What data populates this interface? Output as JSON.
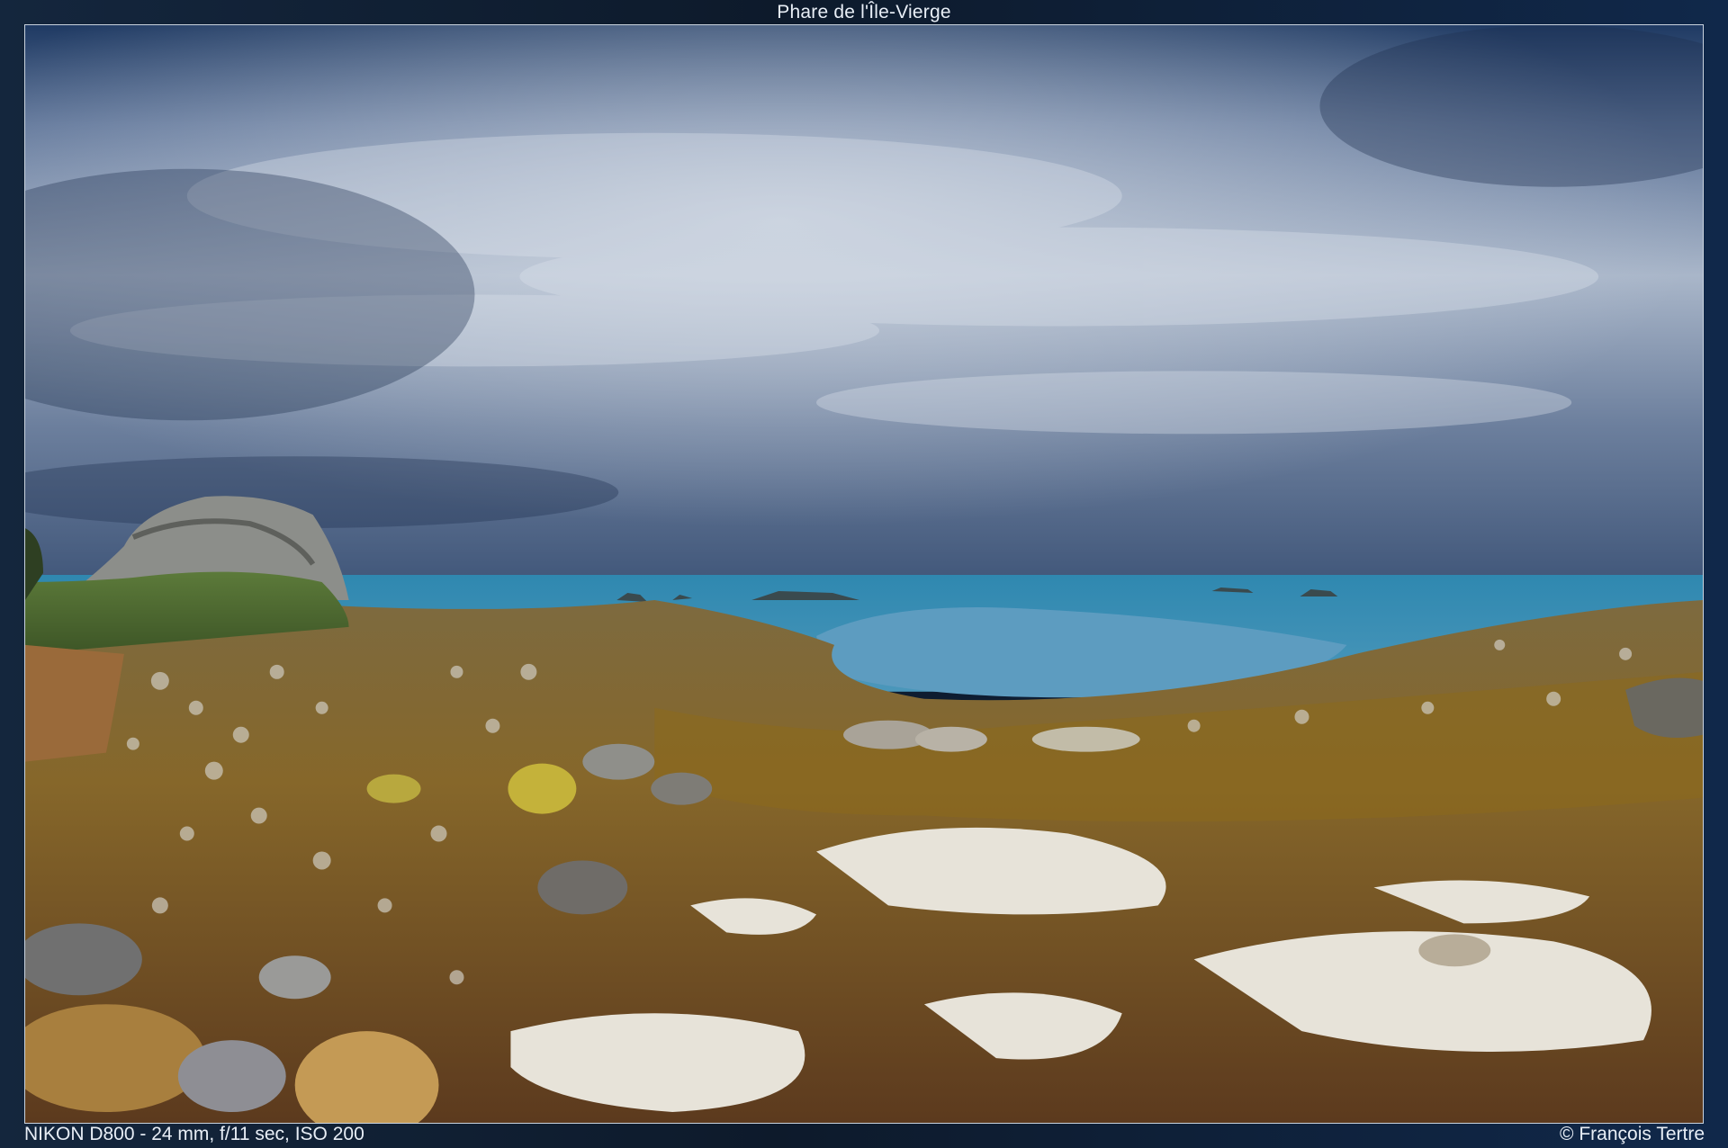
{
  "title": "Phare de l'Île-Vierge",
  "exif": "NIKON D800 - 24 mm, f/11 sec, ISO 200",
  "credit": "© François Tertre",
  "colors": {
    "sky_top": "#2a4a7a",
    "sky_mid": "#8a9cb8",
    "sea": "#3f8fb4",
    "seaweed": "#7a5a1e",
    "sand": "#e6e2d8",
    "rock": "#8f8a80"
  }
}
